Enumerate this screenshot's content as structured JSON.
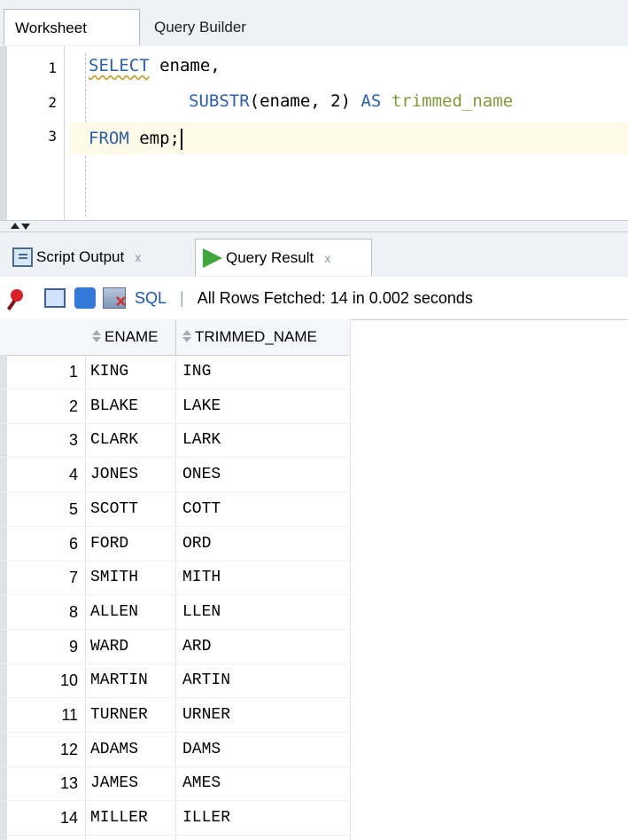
{
  "tabs": {
    "worksheet": "Worksheet",
    "query_builder": "Query Builder"
  },
  "editor": {
    "lines": [
      {
        "number": "1"
      },
      {
        "number": "2"
      },
      {
        "number": "3"
      }
    ],
    "code": {
      "line1_kw": "SELECT",
      "line1_text": " ename,",
      "line2_fn": "SUBSTR",
      "line2_text": "(ename, 2) ",
      "line2_as": "AS",
      "line2_alias": " trimmed_name",
      "line3_kw": "FROM",
      "line3_text": " emp;"
    }
  },
  "result_tabs": {
    "script_output": "Script Output",
    "query_result": "Query Result",
    "close": "x"
  },
  "toolbar": {
    "sql_label": "SQL",
    "separator": "|",
    "status": "All Rows Fetched: 14 in 0.002 seconds"
  },
  "grid": {
    "columns": [
      "ENAME",
      "TRIMMED_NAME"
    ],
    "rows": [
      {
        "num": "1",
        "ename": "KING",
        "trimmed": "ING"
      },
      {
        "num": "2",
        "ename": "BLAKE",
        "trimmed": "LAKE"
      },
      {
        "num": "3",
        "ename": "CLARK",
        "trimmed": "LARK"
      },
      {
        "num": "4",
        "ename": "JONES",
        "trimmed": "ONES"
      },
      {
        "num": "5",
        "ename": "SCOTT",
        "trimmed": "COTT"
      },
      {
        "num": "6",
        "ename": "FORD",
        "trimmed": "ORD"
      },
      {
        "num": "7",
        "ename": "SMITH",
        "trimmed": "MITH"
      },
      {
        "num": "8",
        "ename": "ALLEN",
        "trimmed": "LLEN"
      },
      {
        "num": "9",
        "ename": "WARD",
        "trimmed": "ARD"
      },
      {
        "num": "10",
        "ename": "MARTIN",
        "trimmed": "ARTIN"
      },
      {
        "num": "11",
        "ename": "TURNER",
        "trimmed": "URNER"
      },
      {
        "num": "12",
        "ename": "ADAMS",
        "trimmed": "DAMS"
      },
      {
        "num": "13",
        "ename": "JAMES",
        "trimmed": "AMES"
      },
      {
        "num": "14",
        "ename": "MILLER",
        "trimmed": "ILLER"
      }
    ]
  },
  "colors": {
    "keyword": "#2d5fa8",
    "alias": "#7f9a3b",
    "current_line": "#fffbe8",
    "run_icon": "#3fa53d",
    "link": "#1e54b7"
  },
  "icons": [
    "pin-icon",
    "print-icon",
    "refresh-icon",
    "freeze-icon",
    "script-output-icon",
    "run-icon",
    "sort-icon"
  ]
}
